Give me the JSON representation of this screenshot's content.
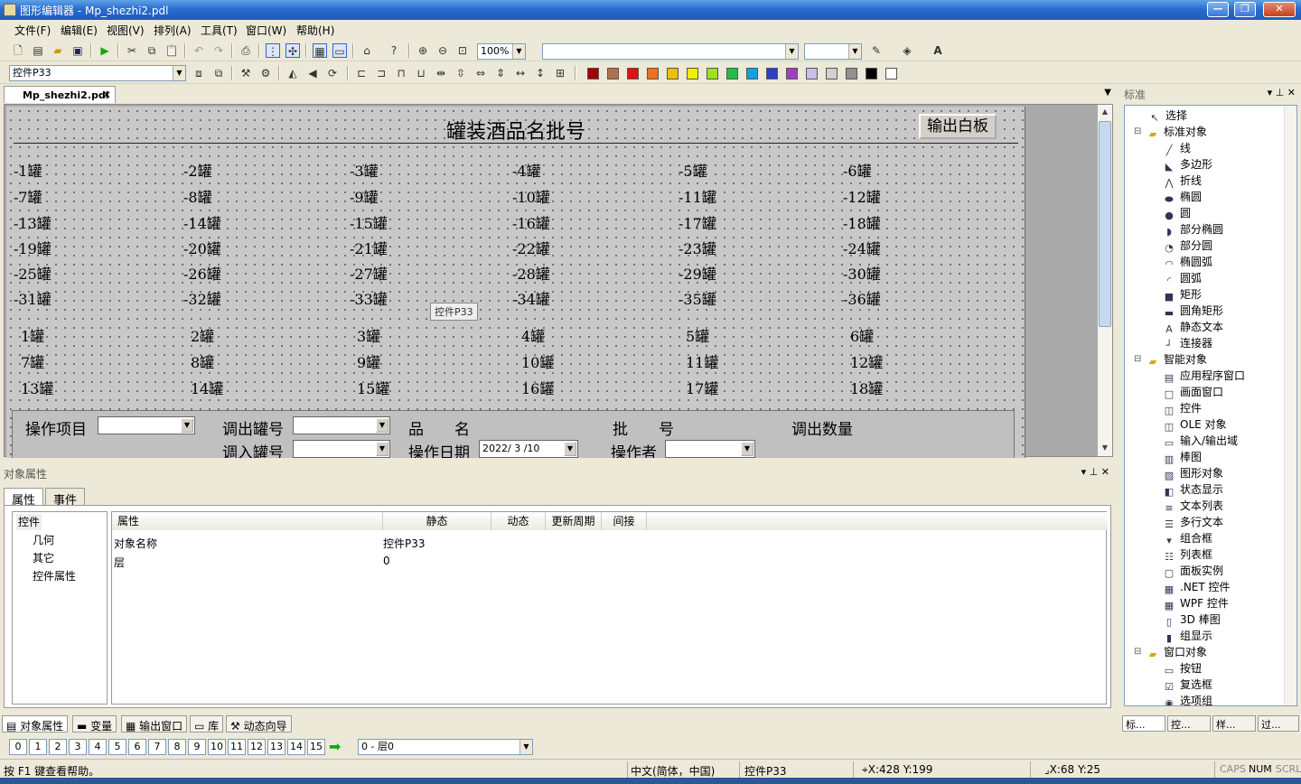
{
  "window": {
    "title": "图形编辑器 - Mp_shezhi2.pdl",
    "min": "—",
    "max": "❐",
    "close": "✕"
  },
  "menu": [
    "文件(F)",
    "编辑(E)",
    "视图(V)",
    "排列(A)",
    "工具(T)",
    "窗口(W)",
    "帮助(H)"
  ],
  "toolbar": {
    "zoom": "100%",
    "object_name": "控件P33"
  },
  "palette": [
    "#a00000",
    "#b07050",
    "#e01010",
    "#f07020",
    "#f0c000",
    "#f0f000",
    "#a0e020",
    "#20c040",
    "#10a0e0",
    "#3040c0",
    "#a040c0",
    "#c8c0e8",
    "#d0d0d0",
    "#909090",
    "#000000",
    "#ffffff"
  ],
  "doc_tab": "Mp_shezhi2.pdl",
  "canvas": {
    "title": "罐装酒品名批号",
    "output_button": "输出白板",
    "neg_tanks": [
      "-1罐",
      "-2罐",
      "-3罐",
      "-4罐",
      "-5罐",
      "-6罐",
      "-7罐",
      "-8罐",
      "-9罐",
      "-10罐",
      "-11罐",
      "-12罐",
      "-13罐",
      "-14罐",
      "-15罐",
      "-16罐",
      "-17罐",
      "-18罐",
      "-19罐",
      "-20罐",
      "-21罐",
      "-22罐",
      "-23罐",
      "-24罐",
      "-25罐",
      "-26罐",
      "-27罐",
      "-28罐",
      "-29罐",
      "-30罐",
      "-31罐",
      "-32罐",
      "-33罐",
      "-34罐",
      "-35罐",
      "-36罐"
    ],
    "pos_tanks": [
      "1罐",
      "2罐",
      "3罐",
      "4罐",
      "5罐",
      "6罐",
      "7罐",
      "8罐",
      "9罐",
      "10罐",
      "11罐",
      "12罐",
      "13罐",
      "14罐",
      "15罐",
      "16罐",
      "17罐",
      "18罐"
    ],
    "tooltip": "控件P33",
    "panel": {
      "op_item": "操作项目",
      "out_tank": "调出罐号",
      "in_tank": "调入罐号",
      "product": "品　　名",
      "batch": "批　　号",
      "out_qty": "调出数量",
      "op_date": "操作日期",
      "date_value": "2022/ 3 /10",
      "operator": "操作者"
    }
  },
  "right_panel": {
    "header": "标准",
    "tree": [
      {
        "label": "选择",
        "level": 1,
        "icon": "pointer-icon"
      },
      {
        "label": "标准对象",
        "level": 0,
        "icon": "folder-icon"
      },
      {
        "label": "线",
        "level": 2,
        "icon": "line-icon"
      },
      {
        "label": "多边形",
        "level": 2,
        "icon": "polygon-icon"
      },
      {
        "label": "折线",
        "level": 2,
        "icon": "polyline-icon"
      },
      {
        "label": "椭圆",
        "level": 2,
        "icon": "ellipse-icon"
      },
      {
        "label": "圆",
        "level": 2,
        "icon": "circle-icon"
      },
      {
        "label": "部分椭圆",
        "level": 2,
        "icon": "ellipse-segment-icon"
      },
      {
        "label": "部分圆",
        "level": 2,
        "icon": "pie-segment-icon"
      },
      {
        "label": "椭圆弧",
        "level": 2,
        "icon": "ellipse-arc-icon"
      },
      {
        "label": "圆弧",
        "level": 2,
        "icon": "arc-icon"
      },
      {
        "label": "矩形",
        "level": 2,
        "icon": "rectangle-icon"
      },
      {
        "label": "圆角矩形",
        "level": 2,
        "icon": "rounded-rect-icon"
      },
      {
        "label": "静态文本",
        "level": 2,
        "icon": "static-text-icon"
      },
      {
        "label": "连接器",
        "level": 2,
        "icon": "connector-icon"
      },
      {
        "label": "智能对象",
        "level": 0,
        "icon": "folder-icon"
      },
      {
        "label": "应用程序窗口",
        "level": 2,
        "icon": "app-window-icon"
      },
      {
        "label": "画面窗口",
        "level": 2,
        "icon": "picture-window-icon"
      },
      {
        "label": "控件",
        "level": 2,
        "icon": "ocx-icon"
      },
      {
        "label": "OLE 对象",
        "level": 2,
        "icon": "ole-icon"
      },
      {
        "label": "输入/输出域",
        "level": 2,
        "icon": "io-field-icon"
      },
      {
        "label": "棒图",
        "level": 2,
        "icon": "bar-icon"
      },
      {
        "label": "图形对象",
        "level": 2,
        "icon": "graphic-object-icon"
      },
      {
        "label": "状态显示",
        "level": 2,
        "icon": "status-display-icon"
      },
      {
        "label": "文本列表",
        "level": 2,
        "icon": "text-list-icon"
      },
      {
        "label": "多行文本",
        "level": 2,
        "icon": "multiline-text-icon"
      },
      {
        "label": "组合框",
        "level": 2,
        "icon": "combobox-icon"
      },
      {
        "label": "列表框",
        "level": 2,
        "icon": "listbox-icon"
      },
      {
        "label": "面板实例",
        "level": 2,
        "icon": "faceplate-icon"
      },
      {
        "label": ".NET 控件",
        "level": 2,
        "icon": "dotnet-icon"
      },
      {
        "label": "WPF 控件",
        "level": 2,
        "icon": "wpf-icon"
      },
      {
        "label": "3D 棒图",
        "level": 2,
        "icon": "bar3d-icon"
      },
      {
        "label": "组显示",
        "level": 2,
        "icon": "group-display-icon"
      },
      {
        "label": "窗口对象",
        "level": 0,
        "icon": "folder-icon"
      },
      {
        "label": "按钮",
        "level": 2,
        "icon": "button-icon"
      },
      {
        "label": "复选框",
        "level": 2,
        "icon": "checkbox-icon"
      },
      {
        "label": "选项组",
        "level": 2,
        "icon": "radio-group-icon"
      }
    ],
    "tabs": [
      "标...",
      "控...",
      "样...",
      "过..."
    ]
  },
  "props": {
    "header": "对象属性",
    "tabs": [
      "属性",
      "事件"
    ],
    "tree": [
      "控件",
      "几何",
      "其它",
      "控件属性"
    ],
    "columns": [
      "属性",
      "静态",
      "动态",
      "更新周期",
      "间接"
    ],
    "rows": [
      {
        "name": "对象名称",
        "value": "控件P33"
      },
      {
        "name": "层",
        "value": "0"
      }
    ]
  },
  "bottom_tabs": [
    "对象属性",
    "变量",
    "输出窗口",
    "库",
    "动态向导"
  ],
  "layers": {
    "buttons": [
      "0",
      "1",
      "2",
      "3",
      "4",
      "5",
      "6",
      "7",
      "8",
      "9",
      "10",
      "11",
      "12",
      "13",
      "14",
      "15"
    ],
    "current": "0 - 层0"
  },
  "status": {
    "help": "按 F1 键查看帮助。",
    "lang": "中文(简体，中国)",
    "object": "控件P33",
    "pos": "X:428 Y:199",
    "size": "X:68 Y:25",
    "caps": "CAPS",
    "num": "NUM",
    "scrl": "SCRL"
  }
}
